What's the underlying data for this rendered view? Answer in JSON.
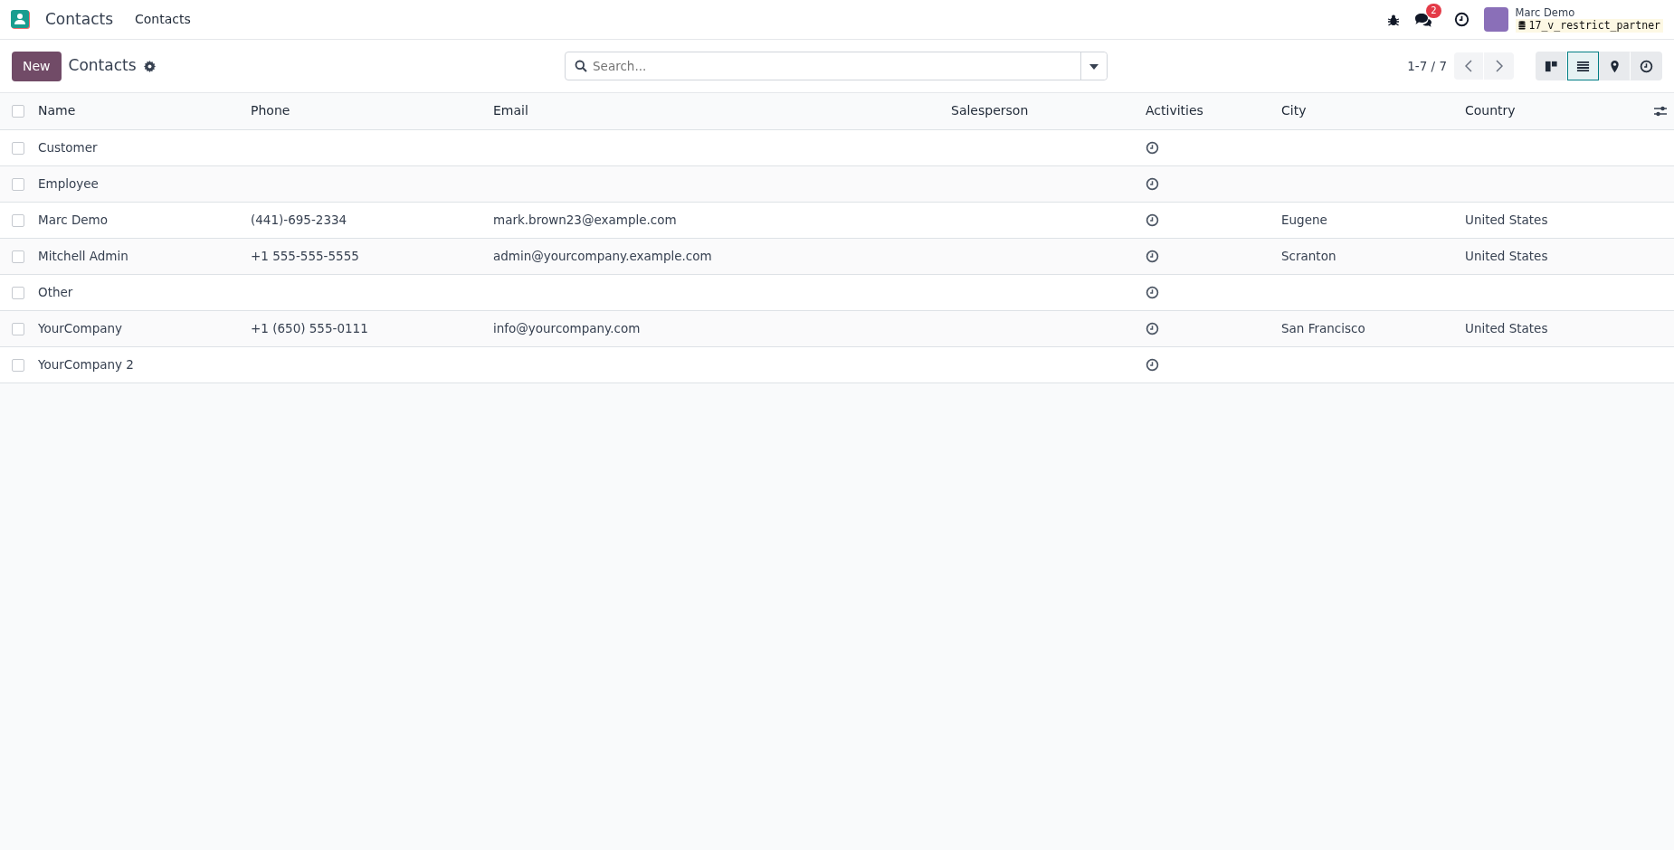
{
  "navbar": {
    "app_name": "Contacts",
    "menu": [
      {
        "label": "Contacts"
      }
    ],
    "notification_count": "2",
    "user_name": "Marc Demo",
    "database": "17_v_restrict_partner"
  },
  "control_panel": {
    "new_button": "New",
    "breadcrumb": "Contacts",
    "search": {
      "placeholder": "Search..."
    },
    "pager": "1-7 / 7",
    "views": [
      {
        "kind": "kanban",
        "selected": false
      },
      {
        "kind": "list",
        "selected": true
      },
      {
        "kind": "map",
        "selected": false
      },
      {
        "kind": "activity",
        "selected": false
      }
    ]
  },
  "table": {
    "select_all_checked": false,
    "columns": [
      {
        "kind": "text",
        "label": "Name"
      },
      {
        "kind": "text",
        "label": "Phone"
      },
      {
        "kind": "text",
        "label": "Email"
      },
      {
        "kind": "text",
        "label": "Salesperson"
      },
      {
        "kind": "activity",
        "label": "Activities"
      },
      {
        "kind": "text",
        "label": "City"
      },
      {
        "kind": "text",
        "label": "Country"
      }
    ],
    "rows": [
      {
        "checked": false,
        "name": "Customer"
      },
      {
        "checked": false,
        "name": "Employee"
      },
      {
        "checked": false,
        "name": "Marc Demo",
        "phone": "(441)-695-2334",
        "email": "mark.brown23@example.com",
        "city": "Eugene",
        "country": "United States"
      },
      {
        "checked": false,
        "name": "Mitchell Admin",
        "phone": "+1 555-555-5555",
        "email": "admin@yourcompany.example.com",
        "city": "Scranton",
        "country": "United States"
      },
      {
        "checked": false,
        "name": "Other"
      },
      {
        "checked": false,
        "name": "YourCompany",
        "phone": "+1 (650) 555-0111",
        "email": "info@yourcompany.com",
        "city": "San Francisco",
        "country": "United States"
      },
      {
        "checked": false,
        "name": "YourCompany 2"
      }
    ]
  }
}
